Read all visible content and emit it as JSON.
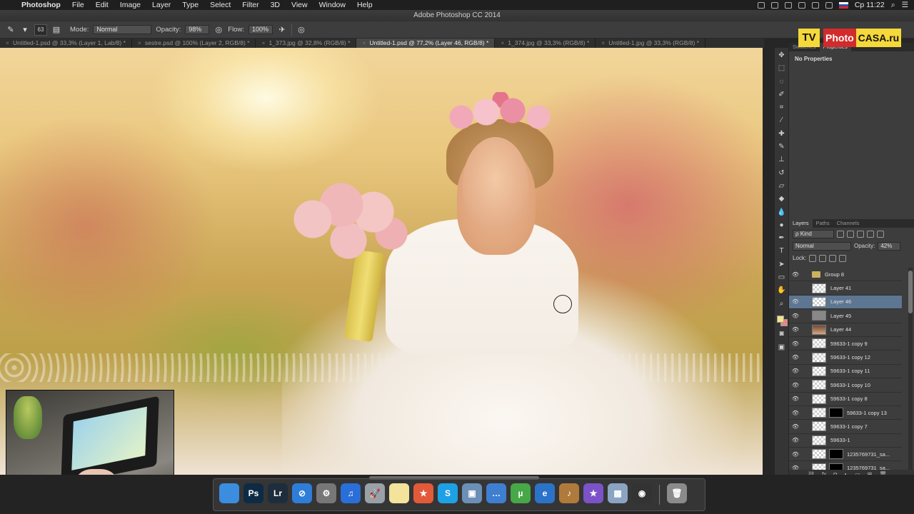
{
  "menubar": {
    "apple": "",
    "app": "Photoshop",
    "items": [
      "File",
      "Edit",
      "Image",
      "Layer",
      "Type",
      "Select",
      "Filter",
      "3D",
      "View",
      "Window",
      "Help"
    ],
    "clock": "Ср 11:22"
  },
  "window": {
    "title": "Adobe Photoshop CC 2014"
  },
  "options": {
    "brush_size": "63",
    "mode_label": "Mode:",
    "mode_value": "Normal",
    "opacity_label": "Opacity:",
    "opacity_value": "98%",
    "flow_label": "Flow:",
    "flow_value": "100%"
  },
  "tabs": [
    {
      "label": "Untitled-1.psd @ 33,3% (Layer 1, Lab/8) *"
    },
    {
      "label": "sestre.psd @ 100% (Layer 2, RGB/8) *"
    },
    {
      "label": "1_373.jpg @ 32,8% (RGB/8) *"
    },
    {
      "label": "Untitled-1.psd @ 77,2% (Layer 46, RGB/8) *"
    },
    {
      "label": "1_374.jpg @ 33,3% (RGB/8) *"
    },
    {
      "label": "Untitled-1.jpg @ 33,3% (RGB/8) *"
    }
  ],
  "logo": {
    "tv": "TV",
    "photo": "Photo",
    "casa": "CASA.ru"
  },
  "properties": {
    "tabs": [
      "Swatches",
      "Properties"
    ],
    "empty_text": "No Properties"
  },
  "layers_panel": {
    "tabs": [
      "Layers",
      "Paths",
      "Channels"
    ],
    "filter": "ρ Kind",
    "blend_mode": "Normal",
    "opacity_label": "Opacity:",
    "opacity_value": "42%",
    "lock_label": "Lock:",
    "layers": [
      {
        "name": "Group 8",
        "kind": "group",
        "visible": true
      },
      {
        "name": "Layer 41",
        "kind": "layer",
        "visible": false
      },
      {
        "name": "Layer 46",
        "kind": "layer",
        "visible": true,
        "selected": true
      },
      {
        "name": "Layer 45",
        "kind": "grey",
        "visible": true
      },
      {
        "name": "Layer 44",
        "kind": "photo",
        "visible": true
      },
      {
        "name": "59633-1 copy 9",
        "kind": "layer",
        "visible": true
      },
      {
        "name": "59633-1 copy 12",
        "kind": "layer",
        "visible": true
      },
      {
        "name": "59633-1 copy 11",
        "kind": "layer",
        "visible": true
      },
      {
        "name": "59633-1 copy 10",
        "kind": "layer",
        "visible": true
      },
      {
        "name": "59633-1 copy 8",
        "kind": "layer",
        "visible": true
      },
      {
        "name": "59633-1 copy 13",
        "kind": "masked",
        "visible": true
      },
      {
        "name": "59633-1 copy 7",
        "kind": "layer",
        "visible": true
      },
      {
        "name": "59633-1",
        "kind": "layer",
        "visible": true
      },
      {
        "name": "1235769731_sa...",
        "kind": "masked",
        "visible": true
      },
      {
        "name": "1235769731_sa...",
        "kind": "masked",
        "visible": true
      }
    ]
  },
  "dock": {
    "apps": [
      {
        "name": "finder",
        "label": "",
        "color": "#3b8de0"
      },
      {
        "name": "photoshop",
        "label": "Ps",
        "color": "#0d2b45"
      },
      {
        "name": "lightroom",
        "label": "Lr",
        "color": "#1d2d3b"
      },
      {
        "name": "safari",
        "label": "⊘",
        "color": "#2e7dd8"
      },
      {
        "name": "system-preferences",
        "label": "⚙",
        "color": "#777"
      },
      {
        "name": "itunes",
        "label": "♫",
        "color": "#2a6ed8"
      },
      {
        "name": "launchpad",
        "label": "🚀",
        "color": "#9aa0a8"
      },
      {
        "name": "notes",
        "label": "",
        "color": "#f3e39b"
      },
      {
        "name": "mendeley",
        "label": "★",
        "color": "#e25a3a"
      },
      {
        "name": "skype",
        "label": "S",
        "color": "#1ea0e5"
      },
      {
        "name": "preview",
        "label": "▣",
        "color": "#6b8fb7"
      },
      {
        "name": "messages",
        "label": "…",
        "color": "#3f7fd1"
      },
      {
        "name": "utorrent",
        "label": "µ",
        "color": "#46a846"
      },
      {
        "name": "edge",
        "label": "e",
        "color": "#2b73c9"
      },
      {
        "name": "guitar",
        "label": "♪",
        "color": "#b07a3c"
      },
      {
        "name": "imovie",
        "label": "★",
        "color": "#7c52c9"
      },
      {
        "name": "photos",
        "label": "▦",
        "color": "#8aa4c2"
      },
      {
        "name": "photo-booth",
        "label": "◉",
        "color": "#333"
      },
      {
        "name": "trash",
        "label": "🗑",
        "color": "#8b8b8b"
      }
    ]
  }
}
